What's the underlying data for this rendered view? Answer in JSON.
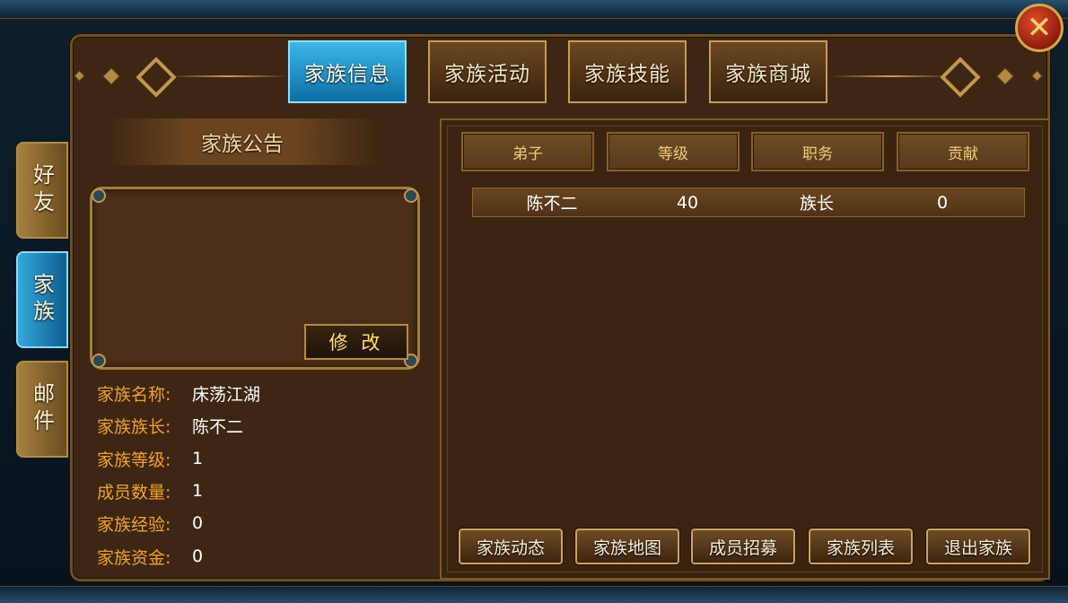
{
  "top_tabs": [
    {
      "label": "家族信息",
      "active": true
    },
    {
      "label": "家族活动",
      "active": false
    },
    {
      "label": "家族技能",
      "active": false
    },
    {
      "label": "家族商城",
      "active": false
    }
  ],
  "side_tabs": [
    {
      "label": "好友",
      "active": false
    },
    {
      "label": "家族",
      "active": true
    },
    {
      "label": "邮件",
      "active": false
    }
  ],
  "notice": {
    "title": "家族公告",
    "content": "",
    "edit_label": "修 改"
  },
  "family_info": [
    {
      "label": "家族名称:",
      "value": "床荡江湖"
    },
    {
      "label": "家族族长:",
      "value": "陈不二"
    },
    {
      "label": "家族等级:",
      "value": "1"
    },
    {
      "label": "成员数量:",
      "value": "1"
    },
    {
      "label": "家族经验:",
      "value": "0"
    },
    {
      "label": "家族资金:",
      "value": "0"
    }
  ],
  "member_table": {
    "headers": [
      "弟子",
      "等级",
      "职务",
      "贡献"
    ],
    "rows": [
      [
        "陈不二",
        "40",
        "族长",
        "0"
      ]
    ]
  },
  "bottom_buttons": [
    "家族动态",
    "家族地图",
    "成员招募",
    "家族列表",
    "退出家族"
  ],
  "close_icon": "close-icon",
  "colors": {
    "active_tab": "#1f8fc7",
    "label_orange": "#f0a12a",
    "panel_brown": "#3d2712",
    "gold_border": "#c59d55"
  }
}
